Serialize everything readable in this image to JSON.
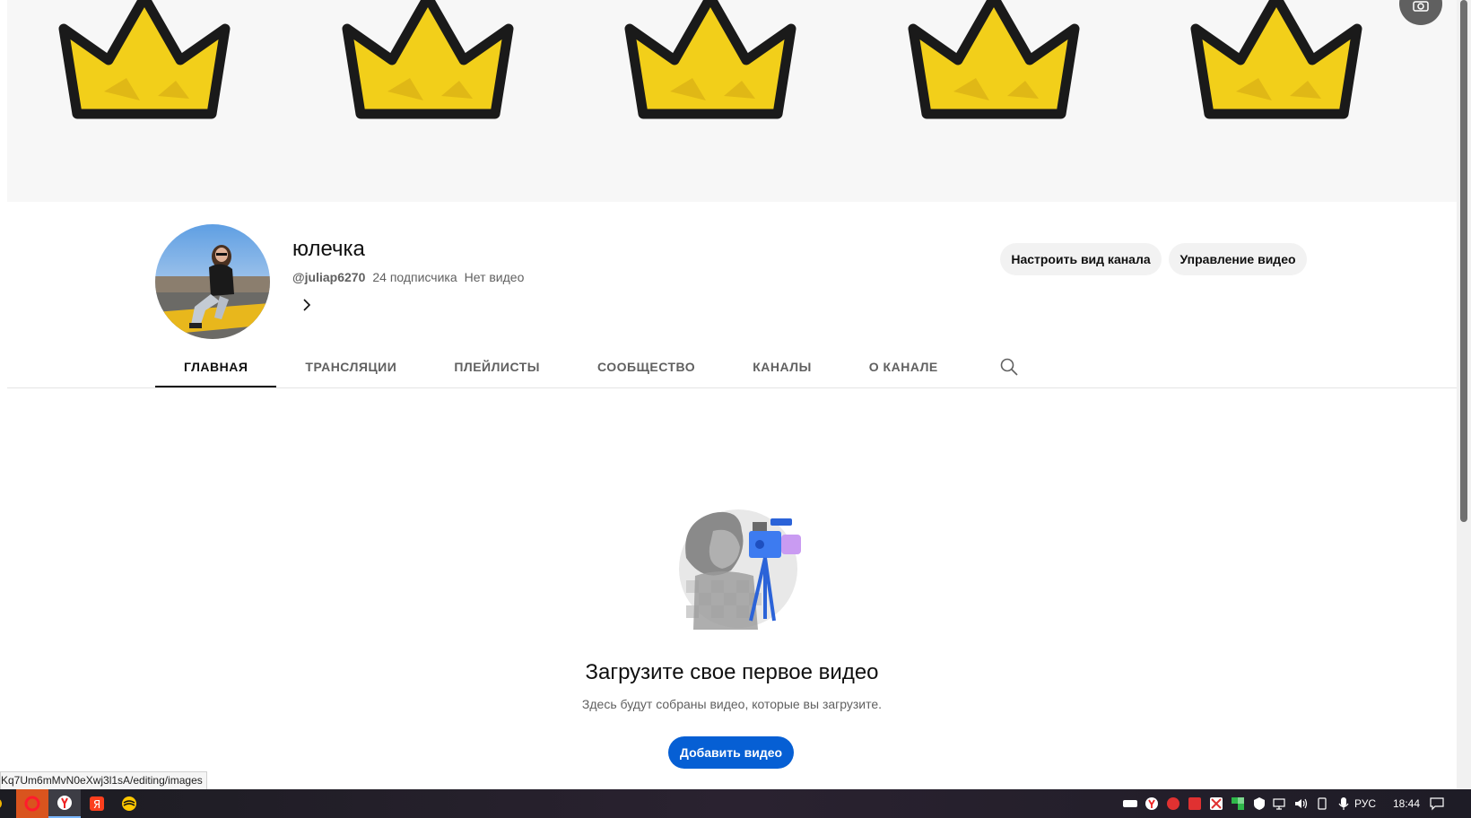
{
  "channel": {
    "name": "юлечка",
    "handle": "@juliap6270",
    "subscribers": "24 подписчика",
    "videos": "Нет видео"
  },
  "actions": {
    "customize_label": "Настроить вид канала",
    "manage_label": "Управление видео"
  },
  "tabs": [
    {
      "label": "ГЛАВНАЯ",
      "active": true
    },
    {
      "label": "ТРАНСЛЯЦИИ",
      "active": false
    },
    {
      "label": "ПЛЕЙЛИСТЫ",
      "active": false
    },
    {
      "label": "СООБЩЕСТВО",
      "active": false
    },
    {
      "label": "КАНАЛЫ",
      "active": false
    },
    {
      "label": "О КАНАЛЕ",
      "active": false
    }
  ],
  "empty_state": {
    "title": "Загрузите свое первое видео",
    "subtitle": "Здесь будут собраны видео, которые вы загрузите.",
    "button_label": "Добавить видео"
  },
  "status_bar": {
    "url": "Kq7Um6mMvN0eXwj3l1sA/editing/images"
  },
  "taskbar": {
    "language": "РУС",
    "time": "18:44"
  },
  "colors": {
    "accent": "#065fd4",
    "crown_fill": "#f2cf1a",
    "crown_outline": "#1a1a1a"
  }
}
